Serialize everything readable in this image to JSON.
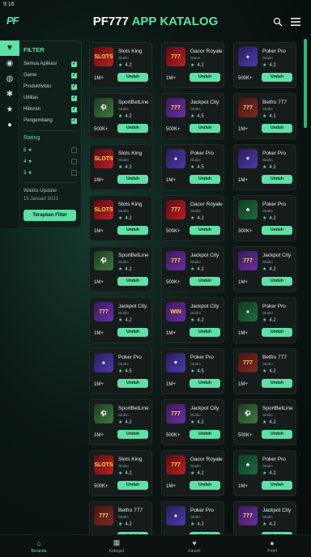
{
  "status": {
    "time": "9:16"
  },
  "header": {
    "logo": "PF",
    "title_main": "PF777",
    "title_accent": "APP KATALOG",
    "search_icon": "search-icon",
    "menu_icon": "menu-icon"
  },
  "sidenav": {
    "icons": [
      "gamepad-icon",
      "controller-icon",
      "compass-icon",
      "gear-icon",
      "star-icon",
      "info-icon"
    ]
  },
  "filter": {
    "title": "FILTER",
    "categories": [
      {
        "label": "Semua Aplikasi",
        "checked": true
      },
      {
        "label": "Game",
        "checked": true
      },
      {
        "label": "Produktivitas",
        "checked": true
      },
      {
        "label": "Utilitas",
        "checked": true
      },
      {
        "label": "Hiburan",
        "checked": true
      },
      {
        "label": "Pengembang",
        "checked": true
      }
    ],
    "rating_title": "Rating",
    "ratings": [
      {
        "label": "5",
        "checked": false
      },
      {
        "label": "4",
        "checked": false
      },
      {
        "label": "3",
        "checked": false
      }
    ],
    "update_label": "Waktu Update",
    "update_date": "15 Januari 2021",
    "apply": "Terapkan Filter"
  },
  "apps": [
    {
      "name": "Slots King",
      "dev": "Studio",
      "rating": "4.2",
      "downloads": "1M+",
      "thumb": "slots",
      "thumb_text": "SLOTS"
    },
    {
      "name": "Gacor Royale",
      "dev": "Gacor",
      "rating": "4.2",
      "downloads": "1M+",
      "thumb": "slots",
      "thumb_text": "777"
    },
    {
      "name": "Poker Pro",
      "dev": "Studio",
      "rating": "4.2",
      "downloads": "500K+",
      "thumb": "poker",
      "thumb_text": "♠"
    },
    {
      "name": "SportBetLine",
      "dev": "Studio",
      "rating": "4.2",
      "downloads": "500K+",
      "thumb": "sport",
      "thumb_text": "⚽"
    },
    {
      "name": "Jackpot City",
      "dev": "Studio",
      "rating": "4.5",
      "downloads": "500K+",
      "thumb": "jackpot",
      "thumb_text": "777"
    },
    {
      "name": "Betfro 777",
      "dev": "Studio",
      "rating": "4.1",
      "downloads": "1M+",
      "thumb": "betfro",
      "thumb_text": "777"
    },
    {
      "name": "Slots King",
      "dev": "Studio",
      "rating": "4.2",
      "downloads": "1M+",
      "thumb": "slots",
      "thumb_text": "SLOTS"
    },
    {
      "name": "Poker Pro",
      "dev": "Studio",
      "rating": "4.5",
      "downloads": "1M+",
      "thumb": "poker",
      "thumb_text": "♠"
    },
    {
      "name": "Poker Pro",
      "dev": "Studio",
      "rating": "4.2",
      "downloads": "1M+",
      "thumb": "poker",
      "thumb_text": "♥"
    },
    {
      "name": "Slots King",
      "dev": "Studio",
      "rating": "4.2",
      "downloads": "1M+",
      "thumb": "slots",
      "thumb_text": "SLOTS"
    },
    {
      "name": "Gacor Royale",
      "dev": "Studio",
      "rating": "4.2",
      "downloads": "500K+",
      "thumb": "slots",
      "thumb_text": "777"
    },
    {
      "name": "Poker Pro",
      "dev": "Studio",
      "rating": "4.2",
      "downloads": "300K+",
      "thumb": "cards",
      "thumb_text": "♣"
    },
    {
      "name": "SportBetLine",
      "dev": "Studio",
      "rating": "4.2",
      "downloads": "1M+",
      "thumb": "sport",
      "thumb_text": "⚽"
    },
    {
      "name": "Jackpot City",
      "dev": "Studio",
      "rating": "4.2",
      "downloads": "500K+",
      "thumb": "jackpot",
      "thumb_text": "777"
    },
    {
      "name": "Jackpot City",
      "dev": "Studio",
      "rating": "4.2",
      "downloads": "1M+",
      "thumb": "jackpot",
      "thumb_text": "777"
    },
    {
      "name": "Jackpot City",
      "dev": "Studio",
      "rating": "4.2",
      "downloads": "1M+",
      "thumb": "jackpot",
      "thumb_text": "777"
    },
    {
      "name": "Jackpot City",
      "dev": "Studio",
      "rating": "4.2",
      "downloads": "1M+",
      "thumb": "jackpot",
      "thumb_text": "WIN"
    },
    {
      "name": "Poker Pro",
      "dev": "Studio",
      "rating": "4.2",
      "downloads": "1M+",
      "thumb": "cards",
      "thumb_text": "♠"
    },
    {
      "name": "Poker Pro",
      "dev": "Studio",
      "rating": "4.5",
      "downloads": "1M+",
      "thumb": "poker",
      "thumb_text": "♠"
    },
    {
      "name": "Poker Pro",
      "dev": "Studio",
      "rating": "4.5",
      "downloads": "1M+",
      "thumb": "poker",
      "thumb_text": "♥"
    },
    {
      "name": "Betfro 777",
      "dev": "Studio",
      "rating": "4.2",
      "downloads": "1M+",
      "thumb": "betfro",
      "thumb_text": "777"
    },
    {
      "name": "SportBetLine",
      "dev": "Studio",
      "rating": "4.2",
      "downloads": "1M+",
      "thumb": "sport",
      "thumb_text": "⚽"
    },
    {
      "name": "Jackpot City",
      "dev": "Studio",
      "rating": "4.2",
      "downloads": "500K+",
      "thumb": "jackpot",
      "thumb_text": "777"
    },
    {
      "name": "SportBetLine",
      "dev": "Studio",
      "rating": "4.2",
      "downloads": "500K+",
      "thumb": "sport",
      "thumb_text": "⚽"
    },
    {
      "name": "Slots King",
      "dev": "Studio",
      "rating": "4.2",
      "downloads": "500K+",
      "thumb": "slots",
      "thumb_text": "SLOTS"
    },
    {
      "name": "Gacor Royale",
      "dev": "Studio",
      "rating": "4.2",
      "downloads": "1M+",
      "thumb": "slots",
      "thumb_text": "777"
    },
    {
      "name": "Poker Pro",
      "dev": "Studio",
      "rating": "4.2",
      "downloads": "1M+",
      "thumb": "cards",
      "thumb_text": "♣"
    },
    {
      "name": "Betfro 777",
      "dev": "Studio",
      "rating": "4.2",
      "downloads": "1M+",
      "thumb": "betfro",
      "thumb_text": "777"
    },
    {
      "name": "Poker Pro",
      "dev": "Studio",
      "rating": "4.2",
      "downloads": "1M+",
      "thumb": "poker",
      "thumb_text": "♠"
    },
    {
      "name": "Jackpot City",
      "dev": "Studio",
      "rating": "4.2",
      "downloads": "1M+",
      "thumb": "jackpot",
      "thumb_text": "777"
    }
  ],
  "card_button": "Unduh",
  "bottomnav": [
    {
      "label": "Beranda",
      "icon": "home-icon",
      "glyph": "⌂",
      "active": true
    },
    {
      "label": "Kategori",
      "icon": "grid-icon",
      "glyph": "▦",
      "active": false
    },
    {
      "label": "Favorit",
      "icon": "heart-icon",
      "glyph": "♥",
      "active": false
    },
    {
      "label": "Profil",
      "icon": "user-icon",
      "glyph": "●",
      "active": false
    }
  ]
}
